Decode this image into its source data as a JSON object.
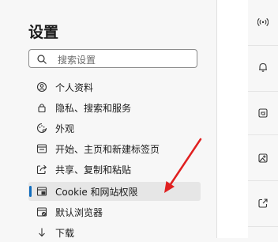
{
  "settings": {
    "title": "设置"
  },
  "search": {
    "placeholder": "搜索设置"
  },
  "nav": {
    "items": [
      {
        "label": "个人资料",
        "icon": "profile-icon"
      },
      {
        "label": "隐私、搜索和服务",
        "icon": "lock-icon"
      },
      {
        "label": "外观",
        "icon": "appearance-icon"
      },
      {
        "label": "开始、主页和新建标签页",
        "icon": "home-icon"
      },
      {
        "label": "共享、复制和粘贴",
        "icon": "share-icon"
      },
      {
        "label": "Cookie 和网站权限",
        "icon": "site-permissions-icon",
        "active": true
      },
      {
        "label": "默认浏览器",
        "icon": "default-browser-icon"
      },
      {
        "label": "下载",
        "icon": "download-icon"
      }
    ]
  },
  "right_icons": [
    "broadcast-icon",
    "bell-icon",
    "settings-tile-icon",
    "image-icon",
    "external-link-icon"
  ],
  "colors": {
    "accent": "#0f6cbd",
    "annotation_arrow": "#e02020",
    "active_bg": "#e6e6e6"
  }
}
